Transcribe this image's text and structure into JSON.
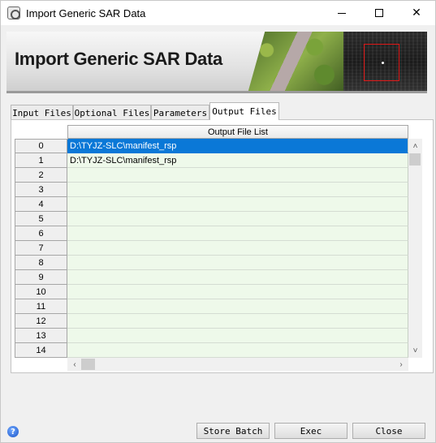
{
  "window": {
    "title": "Import Generic SAR Data",
    "controls": {
      "minimize": "minimize-icon",
      "maximize": "maximize-icon",
      "close": "close-icon"
    }
  },
  "banner": {
    "title": "Import Generic SAR Data"
  },
  "tabs": [
    {
      "label": "Input Files",
      "active": false
    },
    {
      "label": "Optional Files",
      "active": false
    },
    {
      "label": "Parameters",
      "active": false
    },
    {
      "label": "Output Files",
      "active": true
    }
  ],
  "table": {
    "column_header": "Output File List",
    "rows": [
      {
        "num": "0",
        "value": "D:\\TYJZ-SLC\\manifest_rsp",
        "selected": true
      },
      {
        "num": "1",
        "value": "D:\\TYJZ-SLC\\manifest_rsp",
        "selected": false
      },
      {
        "num": "2",
        "value": "",
        "selected": false
      },
      {
        "num": "3",
        "value": "",
        "selected": false
      },
      {
        "num": "4",
        "value": "",
        "selected": false
      },
      {
        "num": "5",
        "value": "",
        "selected": false
      },
      {
        "num": "6",
        "value": "",
        "selected": false
      },
      {
        "num": "7",
        "value": "",
        "selected": false
      },
      {
        "num": "8",
        "value": "",
        "selected": false
      },
      {
        "num": "9",
        "value": "",
        "selected": false
      },
      {
        "num": "10",
        "value": "",
        "selected": false
      },
      {
        "num": "11",
        "value": "",
        "selected": false
      },
      {
        "num": "12",
        "value": "",
        "selected": false
      },
      {
        "num": "13",
        "value": "",
        "selected": false
      },
      {
        "num": "14",
        "value": "",
        "selected": false
      }
    ]
  },
  "footer": {
    "help_icon": "help-icon",
    "buttons": {
      "store_batch": "Store Batch",
      "exec": "Exec",
      "close": "Close"
    }
  },
  "colors": {
    "selection": "#0a78d7",
    "cell_background": "#eef9ea",
    "sar_box": "#e01818"
  }
}
